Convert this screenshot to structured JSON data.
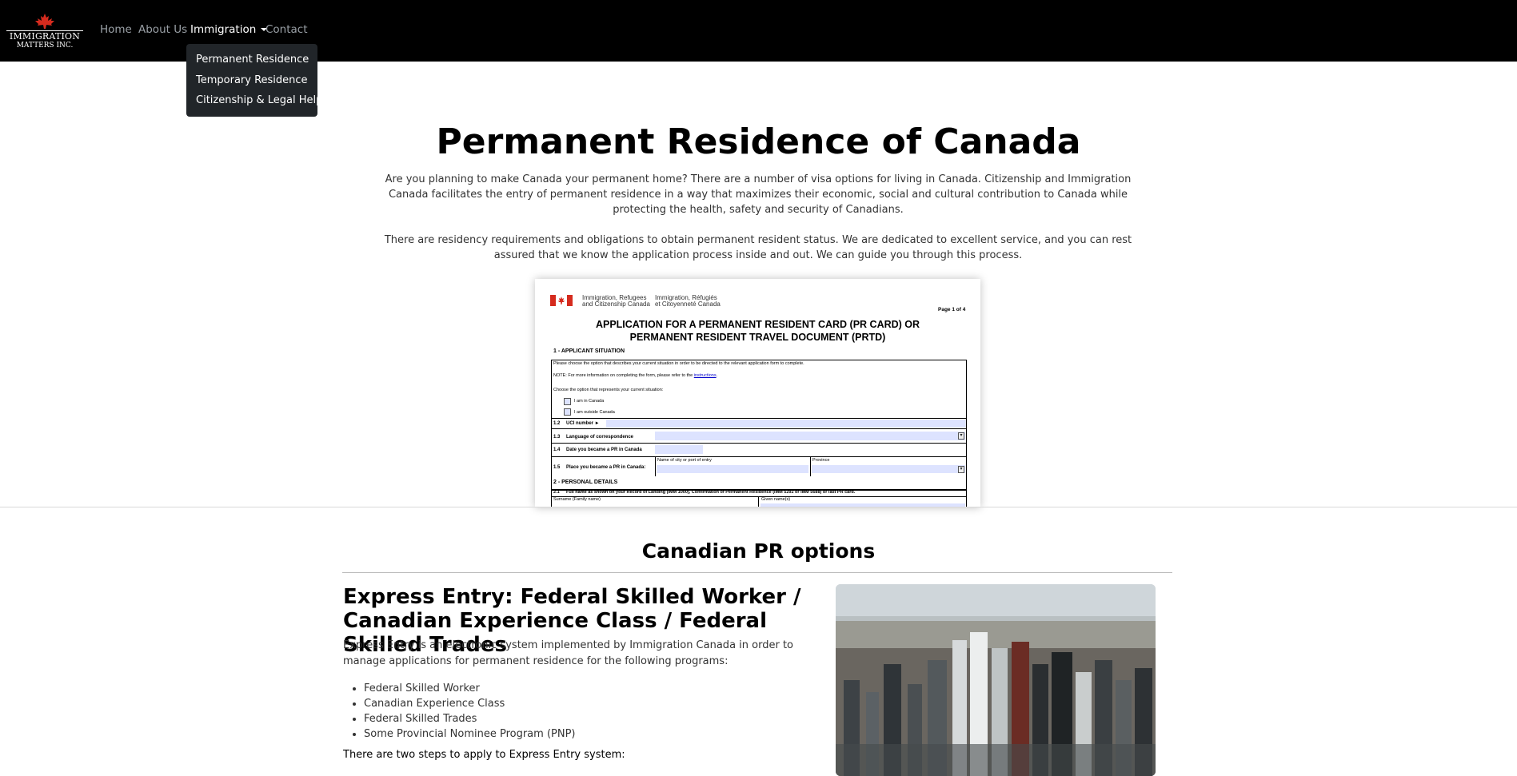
{
  "navbar": {
    "logo_line1": "IMMIGRATION",
    "logo_line2": "MATTERS INC.",
    "links": [
      {
        "label": "Home"
      },
      {
        "label": "About Us"
      },
      {
        "label": "Immigration"
      },
      {
        "label": "Contact"
      }
    ]
  },
  "dropdown": {
    "items": [
      {
        "label": "Permanent Residence"
      },
      {
        "label": "Temporary Residence"
      },
      {
        "label": "Citizenship & Legal Help"
      }
    ]
  },
  "hero": {
    "title": "Permanent Residence of Canada",
    "paragraph1": "Are you planning to make Canada your permanent home? There are a number of visa options for living in Canada. Citizenship and Immigration Canada facilitates the entry of permanent residence in a way that maximizes their economic, social and cultural contribution to Canada while protecting the health, safety and security of Canadians.",
    "paragraph2": "There are residency requirements and obligations to obtain permanent resident status. We are dedicated to excellent service, and you can rest assured that we know the application process inside and out. We can guide you through this process."
  },
  "form_image": {
    "dept_en_1": "Immigration, Refugees",
    "dept_en_2": "and Citizenship Canada",
    "dept_fr_1": "Immigration, Réfugiés",
    "dept_fr_2": "et Citoyenneté Canada",
    "page": "Page 1 of 4",
    "title_1": "APPLICATION FOR A PERMANENT RESIDENT CARD (PR CARD) OR",
    "title_2": "PERMANENT RESIDENT TRAVEL DOCUMENT (PRTD)",
    "s1_heading": "1 - APPLICANT SITUATION",
    "s1_choose": "Please choose the option that describes your current situation in order to be directed to the relevant application form to complete.",
    "s1_note": "NOTE: For more information on completing the form, please refer to the",
    "s1_note_link": "instructions",
    "s1_option_prompt": "Choose the option that represents your current situation:",
    "s1_opt_canada": "I am in Canada",
    "s1_opt_outside": "I am outside Canada",
    "f12": "1.2",
    "f12_label": "UCI number ►",
    "f13": "1.3",
    "f13_label": "Language of correspondence",
    "f14": "1.4",
    "f14_label": "Date you became a PR in Canada",
    "f15": "1.5",
    "f15_label": "Place you became a PR in Canada:",
    "f15_city": "Name of city or port of entry",
    "f15_prov": "Province",
    "s2_heading": "2 - PERSONAL DETAILS",
    "f21": "2.1",
    "f21_label": "Full name as shown on your Record of Landing (IMM 1000), Confirmation of Permanent Residence (IMM 5292 or IMM 5688) or last PR card.",
    "f21_surname": "Surname (Family name)",
    "f21_given": "Given name(s)"
  },
  "pr_options": {
    "title": "Canadian PR options",
    "ee_title": "Express Entry: Federal Skilled Worker / Canadian Experience Class / Federal Skilled Trades",
    "ee_paragraph": "Express Entry is an electronic system implemented by Immigration Canada in order to manage applications for permanent residence for the following programs:",
    "ee_programs": [
      "Federal Skilled Worker",
      "Canadian Experience Class",
      "Federal Skilled Trades",
      "Some Provincial Nominee Program (PNP)"
    ],
    "ee_steps": "There are two steps to apply to Express Entry system:"
  },
  "colors": {
    "navbar_bg": "#000000",
    "dropdown_bg": "#212529",
    "maple_red": "#d52b1e",
    "form_field_fill": "#dde3ff"
  }
}
